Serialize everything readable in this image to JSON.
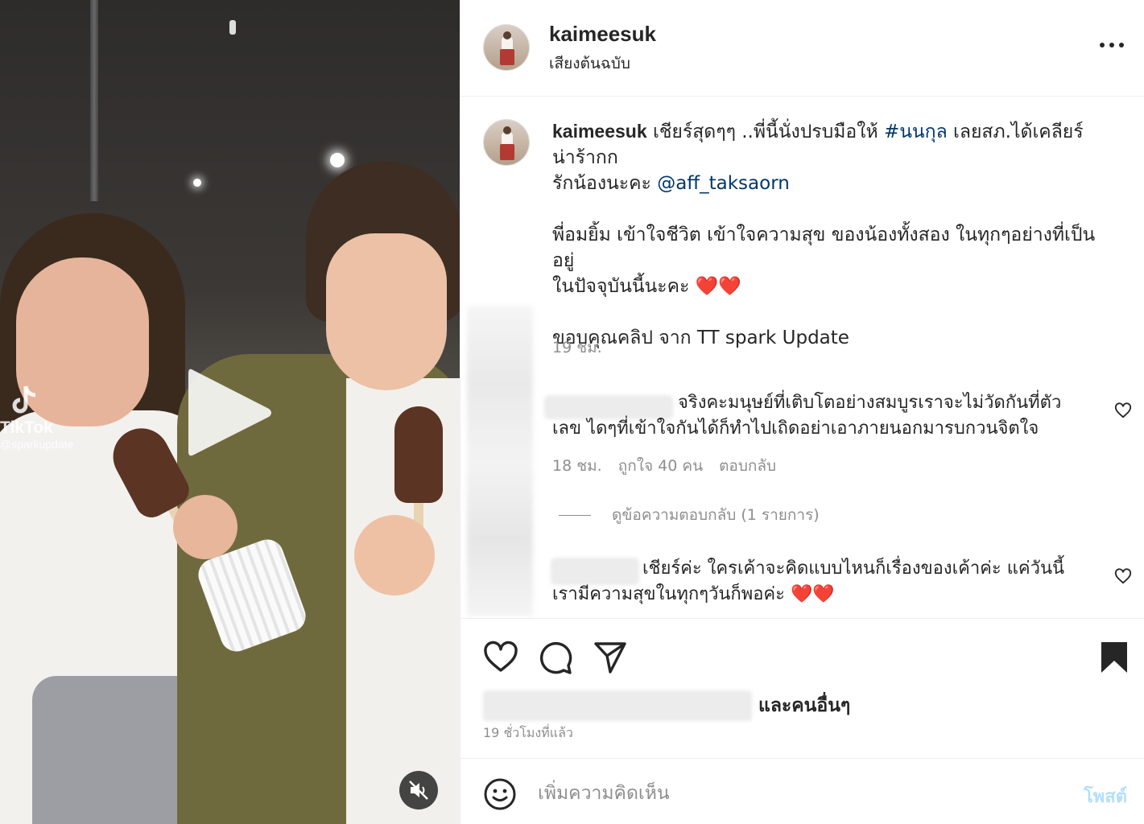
{
  "media": {
    "watermark_brand": "TikTok",
    "watermark_handle": "@sparkupdate"
  },
  "header": {
    "username": "kaimeesuk",
    "audio": "เสียงต้นฉบับ"
  },
  "caption": {
    "username": "kaimeesuk",
    "line1_before": " เชียร์สุดๆๆ ..พี่นี้นั่งปรบมือให้ ",
    "hashtag": "#นนกุล",
    "line1_after": " เลยสภ.ได้เคลียร์",
    "line2": "น่าร้ากก",
    "line3_before": "รักน้องนะคะ ",
    "mention": "@aff_taksaorn",
    "line5": "พี่อมยิ้ม เข้าใจชีวิต เข้าใจความสุข ของน้องทั้งสอง ในทุกๆอย่างที่เป็นอยู่",
    "line6": "ในปัจจุบันนี้นะคะ ❤️❤️",
    "line8": "ขอบคุณคลิป จาก TT spark Update",
    "time": "19 ชม."
  },
  "comments": [
    {
      "line1": "จริงคะมนุษย์ที่เติบโตอย่างสมบูรเราจะไม่วัดกันที่ตัว",
      "line2": "เลข ไดๆที่เข้าใจกันได้ก็ทำไปเถิดอย่าเอาภายนอกมารบกวนจิตใจ",
      "time": "18 ชม.",
      "likes": "ถูกใจ 40 คน",
      "reply": "ตอบกลับ",
      "view_replies": "ดูข้อความตอบกลับ (1 รายการ)"
    },
    {
      "line1": "เชียร์ค่ะ ใครเค้าจะคิดแบบไหนก็เรื่องของเค้าค่ะ แค่วันนี้",
      "line2": "เรามีความสุขในทุกๆวันก็พอค่ะ ❤️❤️"
    }
  ],
  "footer": {
    "likes_suffix": "และคนอื่นๆ",
    "posted": "19 ชั่วโมงที่แล้ว",
    "comment_placeholder": "เพิ่มความคิดเห็น",
    "post_label": "โพสต์"
  },
  "icons": {
    "more": "more-options-icon",
    "like": "heart-icon",
    "comment": "comment-bubble-icon",
    "share": "paper-plane-icon",
    "save": "bookmark-filled-icon",
    "emoji": "smiley-icon",
    "play": "play-icon",
    "mute": "speaker-muted-icon"
  },
  "colors": {
    "link": "#00376b",
    "muted": "#8e8e8e",
    "post_disabled": "#b2dffc",
    "heart": "#e0245e"
  }
}
